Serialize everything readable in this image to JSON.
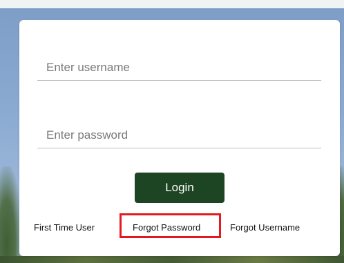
{
  "login_form": {
    "username_placeholder": "Enter username",
    "password_placeholder": "Enter password",
    "login_label": "Login",
    "links": {
      "first_time_user": "First Time User",
      "forgot_password": "Forgot Password",
      "forgot_username": "Forgot Username"
    }
  },
  "colors": {
    "login_button": "#1d4524",
    "highlight_border": "#e41920",
    "background_sky": "#8aaad2",
    "card": "#ffffff"
  }
}
